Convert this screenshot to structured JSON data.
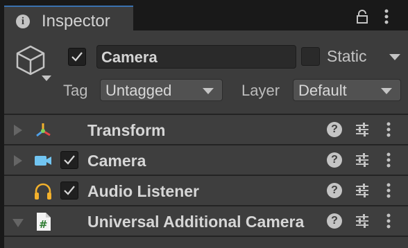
{
  "tab": {
    "title": "Inspector"
  },
  "header": {
    "object_name": "Camera",
    "static_label": "Static",
    "tag_label": "Tag",
    "tag_value": "Untagged",
    "layer_label": "Layer",
    "layer_value": "Default"
  },
  "components": [
    {
      "title": "Transform",
      "icon": "transform-axes-icon"
    },
    {
      "title": "Camera",
      "icon": "camera-icon"
    },
    {
      "title": "Audio Listener",
      "icon": "headphones-icon"
    },
    {
      "title": "Universal Additional Camera",
      "icon": "script-icon"
    }
  ],
  "colors": {
    "panel": "#3c3c3c",
    "tab_accent": "#3a72b0",
    "camera_icon": "#71c5f2",
    "audio_icon": "#f3b12c",
    "script_icon": "#3c8d3c"
  }
}
